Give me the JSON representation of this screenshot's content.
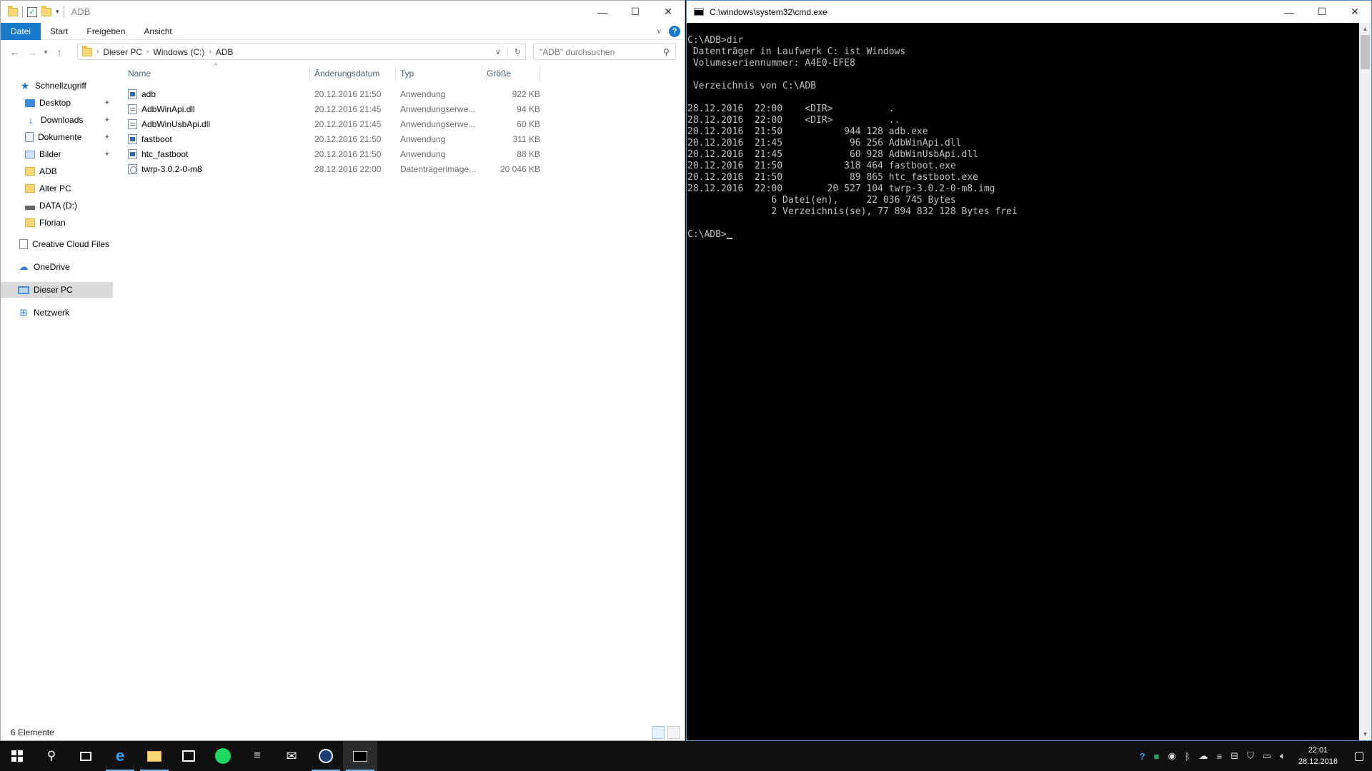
{
  "explorer": {
    "title": "ADB",
    "ribbon_tabs": [
      "Datei",
      "Start",
      "Freigeben",
      "Ansicht"
    ],
    "address": {
      "crumbs": [
        "Dieser PC",
        "Windows (C:)",
        "ADB"
      ]
    },
    "search_placeholder": "\"ADB\" durchsuchen",
    "nav": {
      "quick_access": "Schnellzugriff",
      "items": [
        "Desktop",
        "Downloads",
        "Dokumente",
        "Bilder",
        "ADB",
        "Alter PC",
        "DATA (D:)",
        "Florian"
      ],
      "creative_cloud": "Creative Cloud Files",
      "onedrive": "OneDrive",
      "this_pc": "Dieser PC",
      "network": "Netzwerk"
    },
    "columns": {
      "name": "Name",
      "date": "Änderungsdatum",
      "type": "Typ",
      "size": "Größe"
    },
    "files": [
      {
        "name": "adb",
        "date": "20.12.2016 21:50",
        "type": "Anwendung",
        "size": "922 KB",
        "icon": "exe"
      },
      {
        "name": "AdbWinApi.dll",
        "date": "20.12.2016 21:45",
        "type": "Anwendungserwe...",
        "size": "94 KB",
        "icon": "dll"
      },
      {
        "name": "AdbWinUsbApi.dll",
        "date": "20.12.2016 21:45",
        "type": "Anwendungserwe...",
        "size": "60 KB",
        "icon": "dll"
      },
      {
        "name": "fastboot",
        "date": "20.12.2016 21:50",
        "type": "Anwendung",
        "size": "311 KB",
        "icon": "exe"
      },
      {
        "name": "htc_fastboot",
        "date": "20.12.2016 21:50",
        "type": "Anwendung",
        "size": "88 KB",
        "icon": "exe"
      },
      {
        "name": "twrp-3.0.2-0-m8",
        "date": "28.12.2016 22:00",
        "type": "Datenträgerimage...",
        "size": "20 046 KB",
        "icon": "img"
      }
    ],
    "status": "6 Elemente"
  },
  "cmd": {
    "title": "C:\\windows\\system32\\cmd.exe",
    "output": "C:\\ADB>dir\n Datenträger in Laufwerk C: ist Windows\n Volumeseriennummer: A4E0-EFE8\n\n Verzeichnis von C:\\ADB\n\n28.12.2016  22:00    <DIR>          .\n28.12.2016  22:00    <DIR>          ..\n20.12.2016  21:50           944 128 adb.exe\n20.12.2016  21:45            96 256 AdbWinApi.dll\n20.12.2016  21:45            60 928 AdbWinUsbApi.dll\n20.12.2016  21:50           318 464 fastboot.exe\n20.12.2016  21:50            89 865 htc_fastboot.exe\n28.12.2016  22:00        20 527 104 twrp-3.0.2-0-m8.img\n               6 Datei(en),     22 036 745 Bytes\n               2 Verzeichnis(se), 77 894 832 128 Bytes frei\n\n",
    "prompt": "C:\\ADB>"
  },
  "taskbar": {
    "time": "22:01",
    "date": "28.12.2016"
  },
  "colors": {
    "accent": "#1979ca",
    "taskbar": "#101010",
    "console_text": "#c0c0c0"
  }
}
